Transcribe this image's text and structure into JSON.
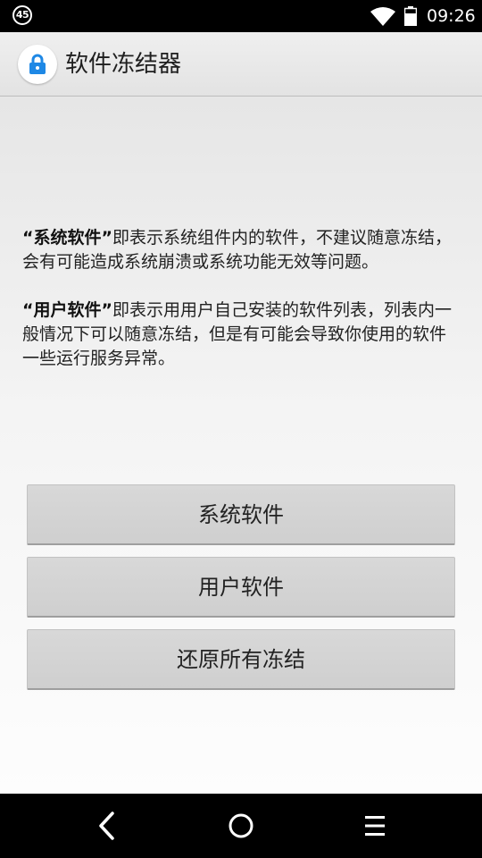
{
  "status_bar": {
    "notification_count": "45",
    "time": "09:26",
    "icons": [
      "wifi-icon",
      "battery-icon"
    ]
  },
  "app_bar": {
    "title": "软件冻结器",
    "icon": "lock-icon",
    "accent": "#1e88e5"
  },
  "descriptions": {
    "system": {
      "bold": "“系统软件”",
      "text": "即表示系统组件内的软件，不建议随意冻结，会有可能造成系统崩溃或系统功能无效等问题。"
    },
    "user": {
      "bold": "“用户软件”",
      "text": "即表示用用户自己安装的软件列表，列表内一般情况下可以随意冻结，但是有可能会导致你使用的软件一些运行服务异常。"
    }
  },
  "buttons": {
    "system_apps": "系统软件",
    "user_apps": "用户软件",
    "restore_all": "还原所有冻结"
  },
  "nav_bar": {
    "icons": [
      "back-icon",
      "home-icon",
      "recents-icon"
    ]
  }
}
